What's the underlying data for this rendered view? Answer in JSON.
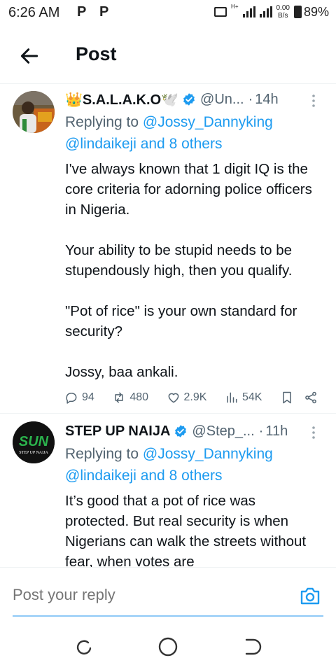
{
  "status_bar": {
    "time": "6:26 AM",
    "notif_1": "P",
    "notif_2": "P",
    "network": "H+",
    "speed_value": "0.00",
    "speed_unit": "B/s",
    "battery": "89%"
  },
  "header": {
    "title": "Post",
    "back_icon": "arrow-left-icon"
  },
  "posts": [
    {
      "name": "👑S.A.L.A.K.O🕊️",
      "handle": "@Un...",
      "dot": "·",
      "time": "14h",
      "reply_prefix": "Replying to",
      "reply_mention": "@Jossy_Dannyking",
      "reply_rest": "@lindaikeji and 8 others",
      "text": "I've always known that 1 digit IQ is the core criteria for adorning police officers in Nigeria.\n\nYour ability to be stupid needs to be stupendously high, then you qualify.\n\n\"Pot of rice\" is your own standard for security?\n\nJossy, baa ankali.",
      "stats": {
        "replies": "94",
        "reposts": "480",
        "likes": "2.9K",
        "views": "54K"
      }
    },
    {
      "name": "STEP UP NAIJA",
      "handle": "@Step_...",
      "dot": "·",
      "time": "11h",
      "reply_prefix": "Replying to",
      "reply_mention": "@Jossy_Dannyking",
      "reply_rest": "@lindaikeji and 8 others",
      "text": "It’s good that a pot of rice was protected. But real security is when Nigerians can walk the streets without fear, when votes are",
      "avatar_logo_text": "SUN",
      "avatar_caption": "STEP UP NAIJA"
    }
  ],
  "reply_bar": {
    "placeholder": "Post your reply",
    "camera_icon": "camera-icon"
  },
  "colors": {
    "accent": "#1d9bf0",
    "verified": "#1d9bf0",
    "text": "#0f1419",
    "muted": "#536471",
    "avatar2_bg": "#111111",
    "avatar2_logo": "#2bb24c"
  }
}
